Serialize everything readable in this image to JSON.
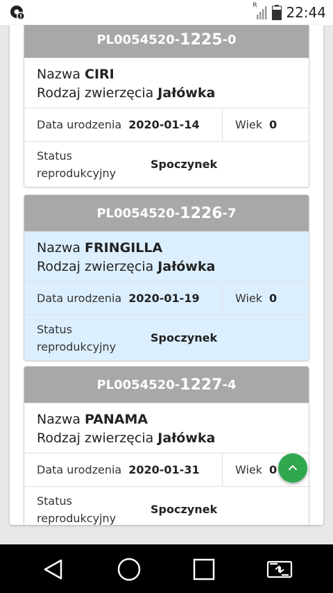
{
  "status_bar": {
    "time": "22:44",
    "signal_badge": "R"
  },
  "cards": [
    {
      "id_prefix": "PL0054520-",
      "id_number": "1225",
      "id_check": "-0",
      "name_label": "Nazwa",
      "name": "CIRI",
      "type_label": "Rodzaj zwierzęcia",
      "type": "Jałówka",
      "birth_label": "Data urodzenia",
      "birth_date": "2020-01-14",
      "age_label": "Wiek",
      "age": "0",
      "status_label_line1": "Status",
      "status_label_line2": "reprodukcyjny",
      "status": "Spoczynek",
      "selected": false
    },
    {
      "id_prefix": "PL0054520-",
      "id_number": "1226",
      "id_check": "-7",
      "name_label": "Nazwa",
      "name": "FRINGILLA",
      "type_label": "Rodzaj zwierzęcia",
      "type": "Jałówka",
      "birth_label": "Data urodzenia",
      "birth_date": "2020-01-19",
      "age_label": "Wiek",
      "age": "0",
      "status_label_line1": "Status",
      "status_label_line2": "reprodukcyjny",
      "status": "Spoczynek",
      "selected": true
    },
    {
      "id_prefix": "PL0054520-",
      "id_number": "1227",
      "id_check": "-4",
      "name_label": "Nazwa",
      "name": "PANAMA",
      "type_label": "Rodzaj zwierzęcia",
      "type": "Jałówka",
      "birth_label": "Data urodzenia",
      "birth_date": "2020-01-31",
      "age_label": "Wiek",
      "age": "0",
      "status_label_line1": "Status",
      "status_label_line2": "reprodukcyjny",
      "status": "Spoczynek",
      "selected": false
    }
  ],
  "fab": {
    "icon": "chevron-up-icon",
    "color": "#2fa84f"
  },
  "nav": {
    "back": "back-icon",
    "home": "home-icon",
    "recents": "recents-icon",
    "rotate": "rotate-screen-icon"
  },
  "colors": {
    "header": "#a8a8a8",
    "selected_row": "#dcefff"
  }
}
